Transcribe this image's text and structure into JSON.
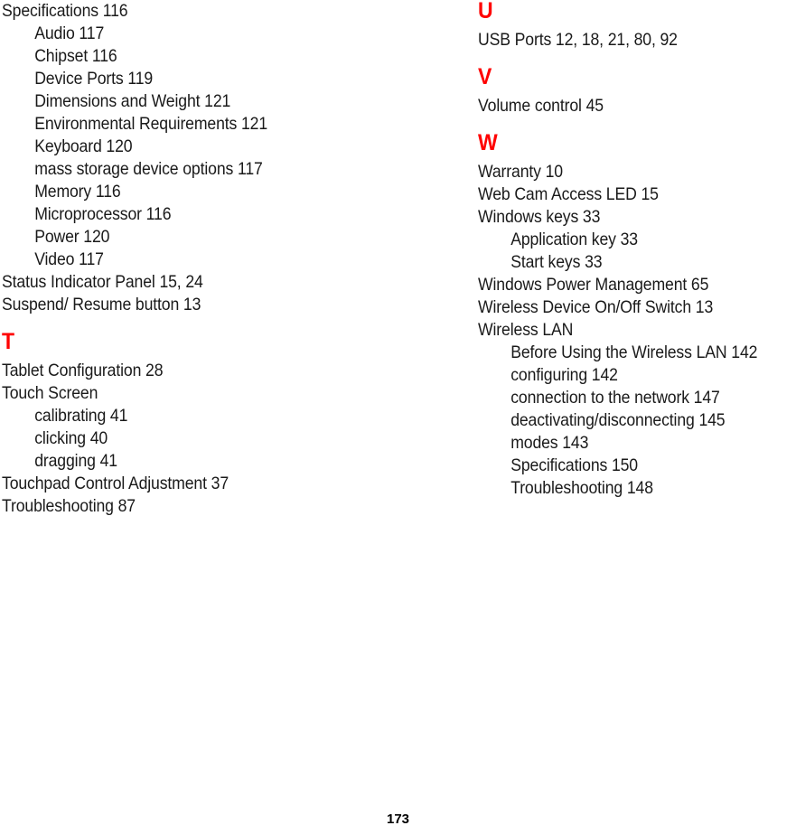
{
  "page": {
    "number": "173",
    "accent_color": "#ff0000",
    "text_color": "#1a1a1a",
    "background_color": "#ffffff"
  },
  "columns": {
    "left": {
      "blocks": [
        {
          "heading": null,
          "entries": [
            {
              "level": 1,
              "text": "Specifications 116"
            },
            {
              "level": 2,
              "text": "Audio 117"
            },
            {
              "level": 2,
              "text": "Chipset 116"
            },
            {
              "level": 2,
              "text": "Device Ports 119"
            },
            {
              "level": 2,
              "text": "Dimensions and Weight 121"
            },
            {
              "level": 2,
              "text": "Environmental Requirements 121"
            },
            {
              "level": 2,
              "text": "Keyboard 120"
            },
            {
              "level": 2,
              "text": "mass storage device options 117"
            },
            {
              "level": 2,
              "text": "Memory 116"
            },
            {
              "level": 2,
              "text": "Microprocessor 116"
            },
            {
              "level": 2,
              "text": "Power 120"
            },
            {
              "level": 2,
              "text": "Video 117"
            },
            {
              "level": 1,
              "text": "Status Indicator Panel 15, 24"
            },
            {
              "level": 1,
              "text": "Suspend/ Resume button 13"
            }
          ]
        },
        {
          "heading": "T",
          "entries": [
            {
              "level": 1,
              "text": "Tablet Configuration 28"
            },
            {
              "level": 1,
              "text": "Touch Screen"
            },
            {
              "level": 2,
              "text": "calibrating 41"
            },
            {
              "level": 2,
              "text": "clicking 40"
            },
            {
              "level": 2,
              "text": "dragging 41"
            },
            {
              "level": 1,
              "text": "Touchpad Control Adjustment 37"
            },
            {
              "level": 1,
              "text": "Troubleshooting 87"
            }
          ]
        }
      ]
    },
    "right": {
      "blocks": [
        {
          "heading": "U",
          "entries": [
            {
              "level": 1,
              "text": "USB Ports 12, 18, 21, 80, 92"
            }
          ]
        },
        {
          "heading": "V",
          "entries": [
            {
              "level": 1,
              "text": "Volume control 45"
            }
          ]
        },
        {
          "heading": "W",
          "entries": [
            {
              "level": 1,
              "text": "Warranty 10"
            },
            {
              "level": 1,
              "text": "Web Cam Access LED 15"
            },
            {
              "level": 1,
              "text": "Windows keys 33"
            },
            {
              "level": 2,
              "text": "Application key 33"
            },
            {
              "level": 2,
              "text": "Start keys 33"
            },
            {
              "level": 1,
              "text": "Windows Power Management 65"
            },
            {
              "level": 1,
              "text": "Wireless Device On/Off Switch 13"
            },
            {
              "level": 1,
              "text": "Wireless LAN"
            },
            {
              "level": 2,
              "text": "Before Using the Wireless LAN 142"
            },
            {
              "level": 2,
              "text": "configuring 142"
            },
            {
              "level": 2,
              "text": "connection to the network 147"
            },
            {
              "level": 2,
              "text": "deactivating/disconnecting 145"
            },
            {
              "level": 2,
              "text": "modes 143"
            },
            {
              "level": 2,
              "text": "Specifications 150"
            },
            {
              "level": 2,
              "text": "Troubleshooting 148"
            }
          ]
        }
      ]
    }
  }
}
